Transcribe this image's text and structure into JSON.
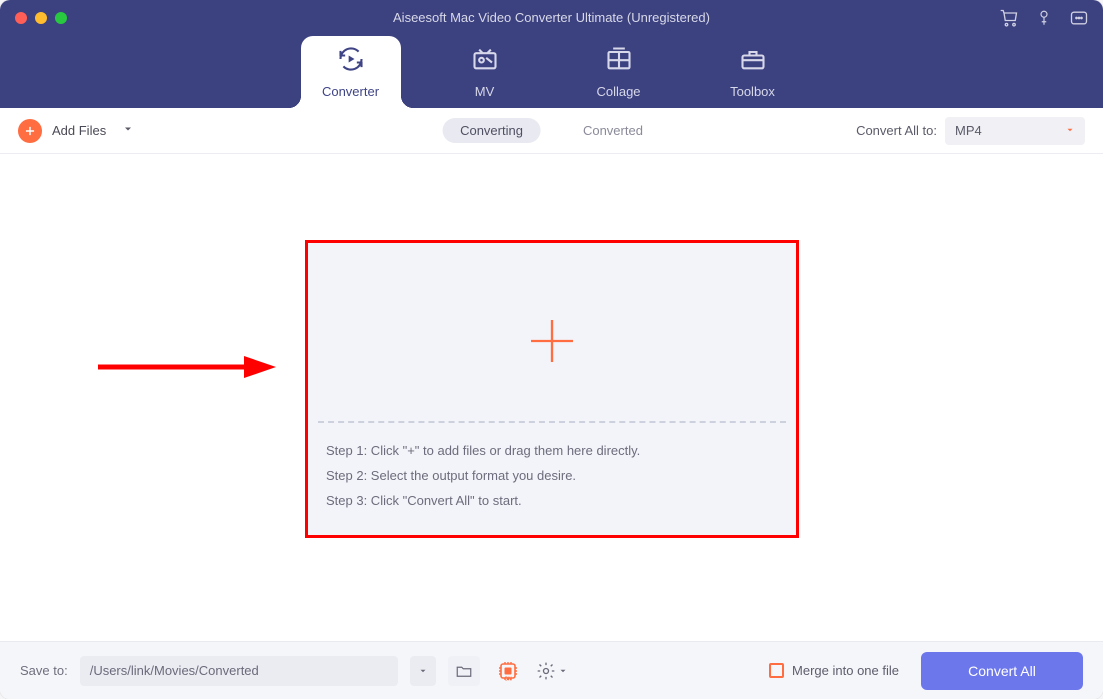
{
  "window": {
    "title": "Aiseesoft Mac Video Converter Ultimate (Unregistered)"
  },
  "tabs": {
    "converter": "Converter",
    "mv": "MV",
    "collage": "Collage",
    "toolbox": "Toolbox"
  },
  "toolbar": {
    "add_files": "Add Files",
    "seg_converting": "Converting",
    "seg_converted": "Converted",
    "convert_all_to": "Convert All to:",
    "format_selected": "MP4"
  },
  "drop": {
    "step1": "Step 1: Click \"+\" to add files or drag them here directly.",
    "step2": "Step 2: Select the output format you desire.",
    "step3": "Step 3: Click \"Convert All\" to start."
  },
  "footer": {
    "save_to": "Save to:",
    "path": "/Users/link/Movies/Converted",
    "merge_label": "Merge into one file",
    "convert_all": "Convert All"
  },
  "colors": {
    "header_bg": "#3c4180",
    "accent_orange": "#ff6d40",
    "accent_blue": "#6d77ec",
    "highlight_red": "#ff0000"
  }
}
